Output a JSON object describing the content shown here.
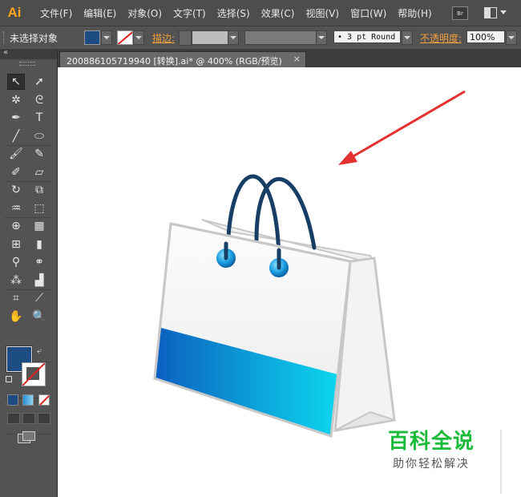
{
  "app": {
    "logo": "Ai"
  },
  "menu": [
    "文件(F)",
    "编辑(E)",
    "对象(O)",
    "文字(T)",
    "选择(S)",
    "效果(C)",
    "视图(V)",
    "窗口(W)",
    "帮助(H)"
  ],
  "topbar": {
    "bridge_label": "Br"
  },
  "control_bar": {
    "selection_status": "未选择对象",
    "fill_color": "#1d4c80",
    "stroke_label": "描边:",
    "stroke_weight": "",
    "brush": "• 3 pt Round",
    "opacity_label": "不透明度:",
    "opacity": "100%"
  },
  "tools_panel": {
    "collapse_glyph": "«",
    "tools": [
      {
        "name": "selection-tool",
        "glyph": "↖"
      },
      {
        "name": "direct-selection-tool",
        "glyph": "➚"
      },
      {
        "name": "magic-wand-tool",
        "glyph": "✲"
      },
      {
        "name": "lasso-tool",
        "glyph": "ᘓ"
      },
      {
        "name": "pen-tool",
        "glyph": "✒"
      },
      {
        "name": "type-tool",
        "glyph": "T"
      },
      {
        "name": "line-segment-tool",
        "glyph": "╱"
      },
      {
        "name": "ellipse-tool",
        "glyph": "⬭"
      },
      {
        "name": "paintbrush-tool",
        "glyph": "🖌"
      },
      {
        "name": "pencil-tool",
        "glyph": "✎"
      },
      {
        "name": "blob-brush-tool",
        "glyph": "✐"
      },
      {
        "name": "eraser-tool",
        "glyph": "▱"
      },
      {
        "name": "rotate-tool",
        "glyph": "↻"
      },
      {
        "name": "scale-tool",
        "glyph": "⧉"
      },
      {
        "name": "warp-tool",
        "glyph": "♒"
      },
      {
        "name": "free-transform-tool",
        "glyph": "⬚"
      },
      {
        "name": "shape-builder-tool",
        "glyph": "⊕"
      },
      {
        "name": "perspective-grid-tool",
        "glyph": "▦"
      },
      {
        "name": "mesh-tool",
        "glyph": "⊞"
      },
      {
        "name": "gradient-tool",
        "glyph": "▮"
      },
      {
        "name": "eyedropper-tool",
        "glyph": "⚲"
      },
      {
        "name": "blend-tool",
        "glyph": "⚭"
      },
      {
        "name": "symbol-sprayer-tool",
        "glyph": "⁂"
      },
      {
        "name": "column-graph-tool",
        "glyph": "▟"
      },
      {
        "name": "artboard-tool",
        "glyph": "⌗"
      },
      {
        "name": "slice-tool",
        "glyph": "⟋"
      },
      {
        "name": "hand-tool",
        "glyph": "✋"
      },
      {
        "name": "zoom-tool",
        "glyph": "🔍"
      }
    ]
  },
  "document": {
    "tab_title": "200886105719940 [转换].ai* @ 400% (RGB/预览)",
    "close_glyph": "×"
  },
  "watermark": {
    "title": "百科全说",
    "subtitle": "助你轻松解决"
  },
  "colors": {
    "bag_blue_dark": "#0b5fbf",
    "bag_blue_light": "#0cd6ee",
    "handle": "#173f66",
    "arrow_red": "#e53030",
    "watermark_green": "#1bbb3a"
  }
}
